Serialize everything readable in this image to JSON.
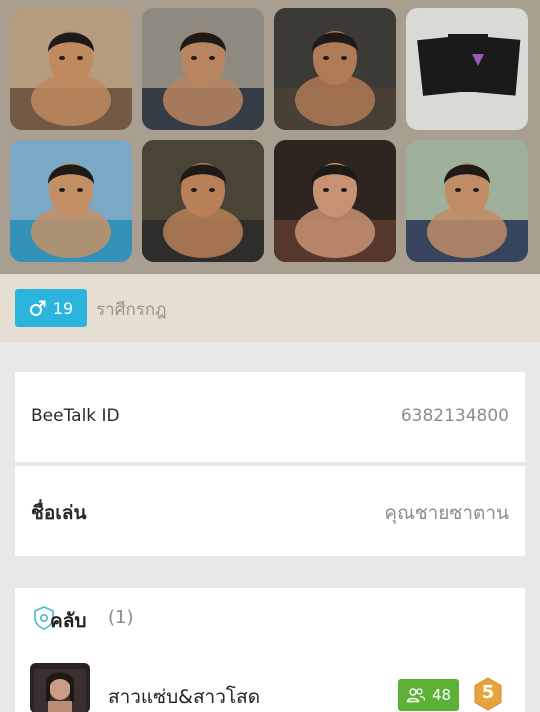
{
  "gallery": {
    "photos": [
      {
        "subject": "shirtless young man selfie on floor",
        "bg": "#b59c7e",
        "skin": "#c08a5e",
        "cloth": "#6a5240"
      },
      {
        "subject": "young man selfie outdoors",
        "bg": "#8f8a80",
        "skin": "#b88560",
        "cloth": "#2c3440"
      },
      {
        "subject": "shirtless young man selfie dark room",
        "bg": "#3b3a36",
        "skin": "#b07a55",
        "cloth": "#4a4036"
      },
      {
        "subject": "black product packets on white",
        "bg": "#d9dad6",
        "skin": "#1a1a1a",
        "cloth": "#9b5ab8"
      },
      {
        "subject": "two young men selfie",
        "bg": "#7ba8c4",
        "skin": "#c39066",
        "cloth": "#2c8fb8"
      },
      {
        "subject": "shirtless young man lying down",
        "bg": "#4a4437",
        "skin": "#b78056",
        "cloth": "#2b2b2b"
      },
      {
        "subject": "close up face selfie",
        "bg": "#2e2420",
        "skin": "#c89272",
        "cloth": "#5a3a30"
      },
      {
        "subject": "young man selfie outdoors",
        "bg": "#9fb09a",
        "skin": "#c08c66",
        "cloth": "#2a3a56"
      }
    ]
  },
  "profile": {
    "gender_icon": "male-icon",
    "age": "19",
    "zodiac": "ราศีกรกฎ",
    "beetalk_id_label": "BeeTalk ID",
    "beetalk_id_value": "6382134800",
    "nickname_label": "ชื่อเล่น",
    "nickname_value": "คุณชายซาตาน"
  },
  "clubs": {
    "icon": "shield-icon",
    "title": "คลับ",
    "count": "(1)",
    "items": [
      {
        "name": "สาวแซ่บ&สาวโสด",
        "members": "48",
        "level": "5",
        "members_icon": "group-icon"
      }
    ]
  },
  "colors": {
    "accent_blue": "#2bb5dc",
    "member_green": "#5cb035",
    "level_orange": "#e8a43c"
  }
}
